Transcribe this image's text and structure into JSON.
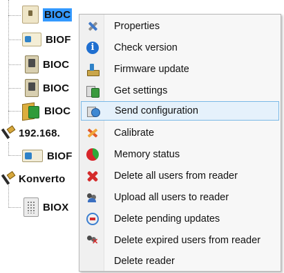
{
  "tree": {
    "nodes": [
      {
        "label": "BIOC",
        "icon": "biometric-reader-icon",
        "selected": true
      },
      {
        "label": "BIOF",
        "icon": "card-reader-icon"
      },
      {
        "label": "BIOC",
        "icon": "fingerprint-reader-icon"
      },
      {
        "label": "BIOC",
        "icon": "fingerprint-reader-icon"
      },
      {
        "label": "BIOC",
        "icon": "door-controller-icon"
      },
      {
        "label": "192.168.",
        "icon": "network-connection-icon"
      },
      {
        "label": "BIOF",
        "icon": "card-reader-icon"
      },
      {
        "label": "Konverto",
        "icon": "network-connection-icon"
      },
      {
        "label": "BIOX",
        "icon": "keypad-reader-icon"
      }
    ]
  },
  "context_menu": {
    "items": [
      {
        "label": "Properties",
        "icon": "properties-tools-icon"
      },
      {
        "label": "Check version",
        "icon": "info-icon"
      },
      {
        "label": "Firmware update",
        "icon": "firmware-update-icon"
      },
      {
        "label": "Get settings",
        "icon": "get-settings-icon"
      },
      {
        "label": "Send configuration",
        "icon": "send-configuration-icon",
        "highlighted": true
      },
      {
        "label": "Calibrate",
        "icon": "calibrate-icon"
      },
      {
        "label": "Memory status",
        "icon": "memory-pie-icon"
      },
      {
        "label": "Delete all users from reader",
        "icon": "delete-red-x-icon"
      },
      {
        "label": "Upload all users to reader",
        "icon": "upload-users-icon"
      },
      {
        "label": "Delete pending updates",
        "icon": "delete-pending-icon"
      },
      {
        "label": "Delete expired users from reader",
        "icon": "delete-expired-users-icon"
      },
      {
        "label": "Delete reader",
        "icon": ""
      }
    ]
  },
  "colors": {
    "selection": "#3399ff",
    "menu_hover_bg": "#e5f1fb",
    "menu_hover_border": "#7ab8e6",
    "menu_bg": "#f7f7f7"
  }
}
